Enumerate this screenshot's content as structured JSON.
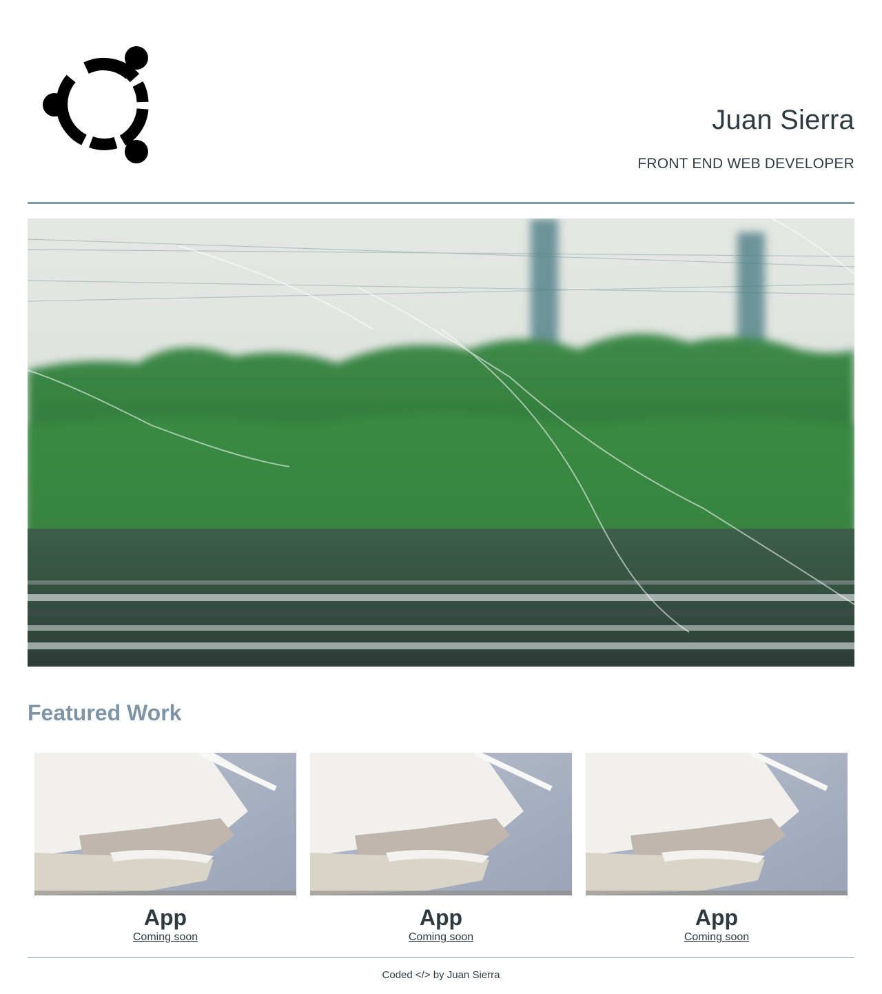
{
  "header": {
    "name": "Juan Sierra",
    "role": "FRONT END WEB DEVELOPER",
    "logo_icon": "ubuntu-circle-of-friends-icon"
  },
  "hero": {
    "image": "rainy-train-window-photo"
  },
  "featured": {
    "title": "Featured Work",
    "items": [
      {
        "title": "App",
        "link_label": "Coming soon",
        "image": "white-architecture-photo"
      },
      {
        "title": "App",
        "link_label": "Coming soon",
        "image": "white-architecture-photo"
      },
      {
        "title": "App",
        "link_label": "Coming soon",
        "image": "white-architecture-photo"
      }
    ]
  },
  "footer": {
    "text": "Coded </> by Juan Sierra"
  },
  "colors": {
    "accent": "#7f95a6",
    "text": "#2f3a40"
  }
}
